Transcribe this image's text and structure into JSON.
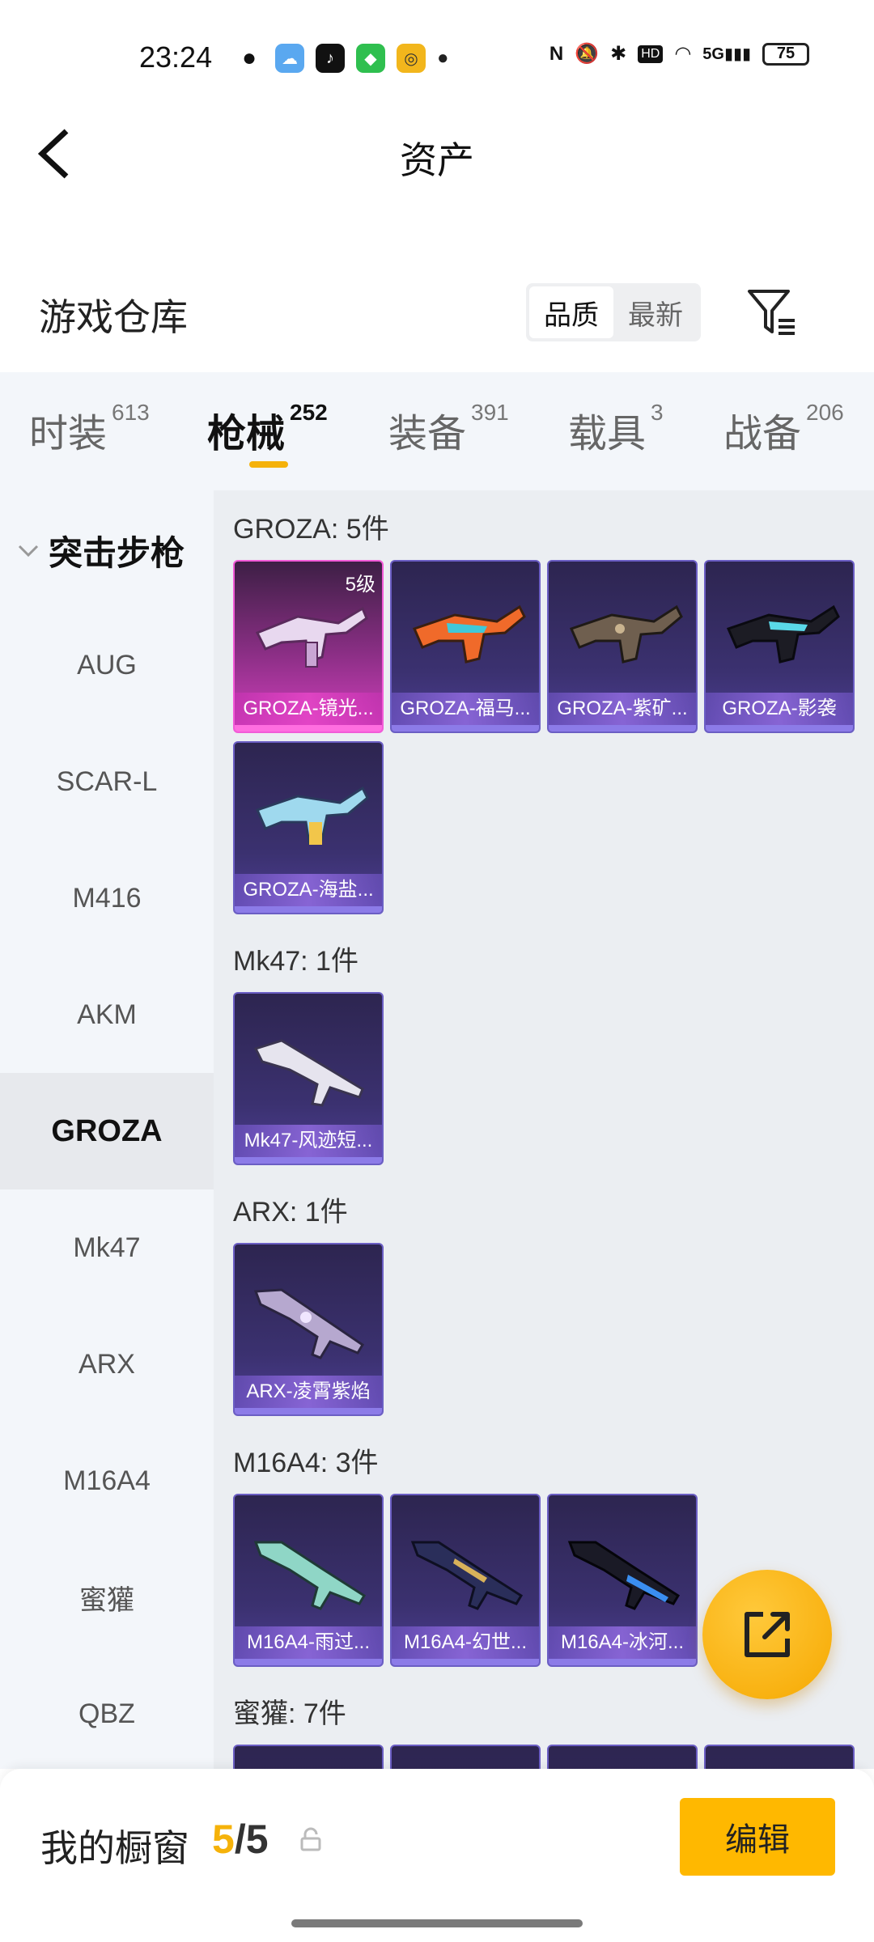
{
  "status_bar": {
    "time": "23:24",
    "network": "5G",
    "battery": "75",
    "hd": "HD"
  },
  "header": {
    "title": "资产"
  },
  "section": {
    "title": "游戏仓库",
    "sort_options": [
      "品质",
      "最新"
    ]
  },
  "tabs": [
    {
      "label": "时装",
      "count": "613"
    },
    {
      "label": "枪械",
      "count": "252"
    },
    {
      "label": "装备",
      "count": "391"
    },
    {
      "label": "载具",
      "count": "3"
    },
    {
      "label": "战备",
      "count": "206"
    }
  ],
  "sidebar": {
    "group": "突击步枪",
    "items": [
      "AUG",
      "SCAR-L",
      "M416",
      "AKM",
      "GROZA",
      "Mk47",
      "ARX",
      "M16A4",
      "蜜獾",
      "QBZ"
    ]
  },
  "groups": [
    {
      "title": "GROZA: 5件",
      "items": [
        {
          "label": "GROZA-镜光...",
          "level": "5级"
        },
        {
          "label": "GROZA-福马..."
        },
        {
          "label": "GROZA-紫矿..."
        },
        {
          "label": "GROZA-影袭"
        },
        {
          "label": "GROZA-海盐..."
        }
      ]
    },
    {
      "title": "Mk47: 1件",
      "items": [
        {
          "label": "Mk47-风迹短..."
        }
      ]
    },
    {
      "title": "ARX: 1件",
      "items": [
        {
          "label": "ARX-凌霄紫焰"
        }
      ]
    },
    {
      "title": "M16A4: 3件",
      "items": [
        {
          "label": "M16A4-雨过..."
        },
        {
          "label": "M16A4-幻世..."
        },
        {
          "label": "M16A4-冰河..."
        }
      ]
    },
    {
      "title": "蜜獾: 7件",
      "items": []
    }
  ],
  "bottom": {
    "label": "我的橱窗",
    "count_current": "5",
    "count_sep": "/",
    "count_total": "5",
    "edit_label": "编辑"
  },
  "colors": {
    "accent": "#f5b20a",
    "card_purple": "#3b3170",
    "card_pink": "#d33fbd"
  }
}
